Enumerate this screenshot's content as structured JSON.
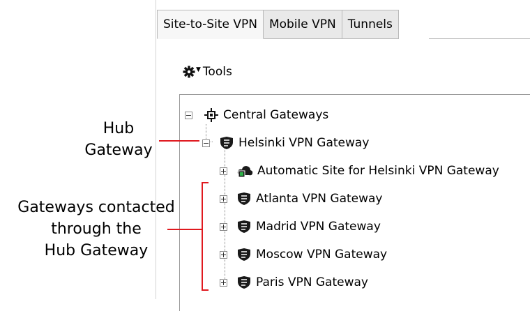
{
  "tabs": [
    {
      "label": "Site-to-Site VPN",
      "active": true
    },
    {
      "label": "Mobile VPN",
      "active": false
    },
    {
      "label": "Tunnels",
      "active": false
    }
  ],
  "toolbar": {
    "tools_label": "Tools",
    "tools_icon": "gear-icon"
  },
  "tree": {
    "root": {
      "label": "Central Gateways",
      "icon": "central-gateways-icon",
      "expanded": true
    },
    "hub": {
      "label": "Helsinki VPN Gateway",
      "icon": "vpn-gateway-shield-icon",
      "expanded": true
    },
    "children": [
      {
        "label": "Automatic Site for Helsinki VPN Gateway",
        "icon": "automatic-site-cloud-icon"
      },
      {
        "label": "Atlanta VPN Gateway",
        "icon": "vpn-gateway-shield-icon"
      },
      {
        "label": "Madrid VPN Gateway",
        "icon": "vpn-gateway-shield-icon"
      },
      {
        "label": "Moscow VPN Gateway",
        "icon": "vpn-gateway-shield-icon"
      },
      {
        "label": "Paris VPN Gateway",
        "icon": "vpn-gateway-shield-icon"
      }
    ]
  },
  "annotations": {
    "hub_line1": "Hub",
    "hub_line2": "Gateway",
    "contacted_line1": "Gateways contacted",
    "contacted_line2": "through the",
    "contacted_line3": "Hub Gateway",
    "color": "#e0191f"
  }
}
